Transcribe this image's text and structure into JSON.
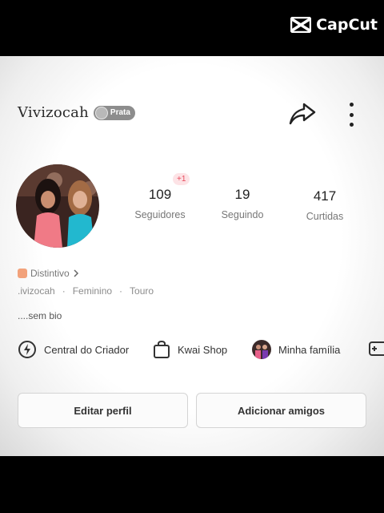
{
  "watermark": {
    "text": "CapCut"
  },
  "profile": {
    "username": "Vivizocah",
    "badge_label": "Prata",
    "stats": [
      {
        "value": "109",
        "label": "Seguidores"
      },
      {
        "value": "19",
        "label": "Seguindo"
      },
      {
        "value": "417",
        "label": "Curtidas"
      }
    ],
    "new_followers_badge": "+1",
    "distintivo_label": "Distintivo",
    "meta": [
      ".ivizocah",
      "·",
      "Feminino",
      "·",
      "Touro"
    ],
    "bio": "....sem bio"
  },
  "shortcuts": [
    {
      "label": "Central do Criador",
      "icon": "lightning-icon"
    },
    {
      "label": "Kwai Shop",
      "icon": "shopping-bag-icon"
    },
    {
      "label": "Minha família",
      "icon": "family-avatar"
    }
  ],
  "buttons": {
    "edit": "Editar perfil",
    "add": "Adicionar amigos"
  },
  "colors": {
    "accent_pink": "#e74a5c",
    "badge_gray": "#8d8d8d"
  }
}
